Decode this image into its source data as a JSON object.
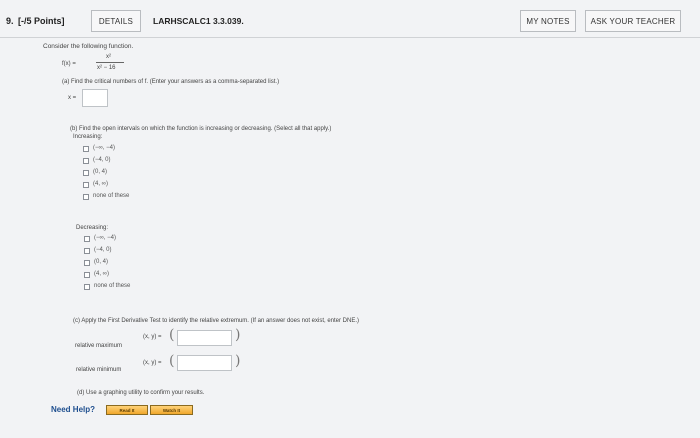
{
  "header": {
    "question": "9.",
    "points": "[-/5 Points]",
    "details": "DETAILS",
    "code": "LARHSCALC1 3.3.039.",
    "my_notes": "MY NOTES",
    "ask_teacher": "ASK YOUR TEACHER"
  },
  "intro": "Consider the following function.",
  "function": {
    "lhs": "f(x) =",
    "numerator": "x²",
    "denominator": "x² − 16"
  },
  "part_a": {
    "prompt": "(a) Find the critical numbers of f. (Enter your answers as a comma-separated list.)",
    "label": "x =",
    "value": ""
  },
  "part_b": {
    "prompt": "(b) Find the open intervals on which the function is increasing or decreasing. (Select all that apply.)",
    "increasing_label": "Increasing:",
    "increasing_options": [
      "(−∞, −4)",
      "(−4, 0)",
      "(0, 4)",
      "(4, ∞)",
      "none of these"
    ],
    "decreasing_label": "Decreasing:",
    "decreasing_options": [
      "(−∞, −4)",
      "(−4, 0)",
      "(0, 4)",
      "(4, ∞)",
      "none of these"
    ]
  },
  "part_c": {
    "prompt": "(c) Apply the First Derivative Test to identify the relative extremum. (If an answer does not exist, enter DNE.)",
    "max_label": "relative maximum",
    "min_label": "relative minimum",
    "coord_label": "(x, y) =",
    "open_paren": "(",
    "close_paren": ")"
  },
  "part_d": {
    "prompt": "(d) Use a graphing utility to confirm your results."
  },
  "help": {
    "label": "Need Help?",
    "read": "Read It",
    "watch": "Watch It"
  },
  "colors": {
    "help_text": "#1f4f8f",
    "help_button": "#f0a72b"
  }
}
